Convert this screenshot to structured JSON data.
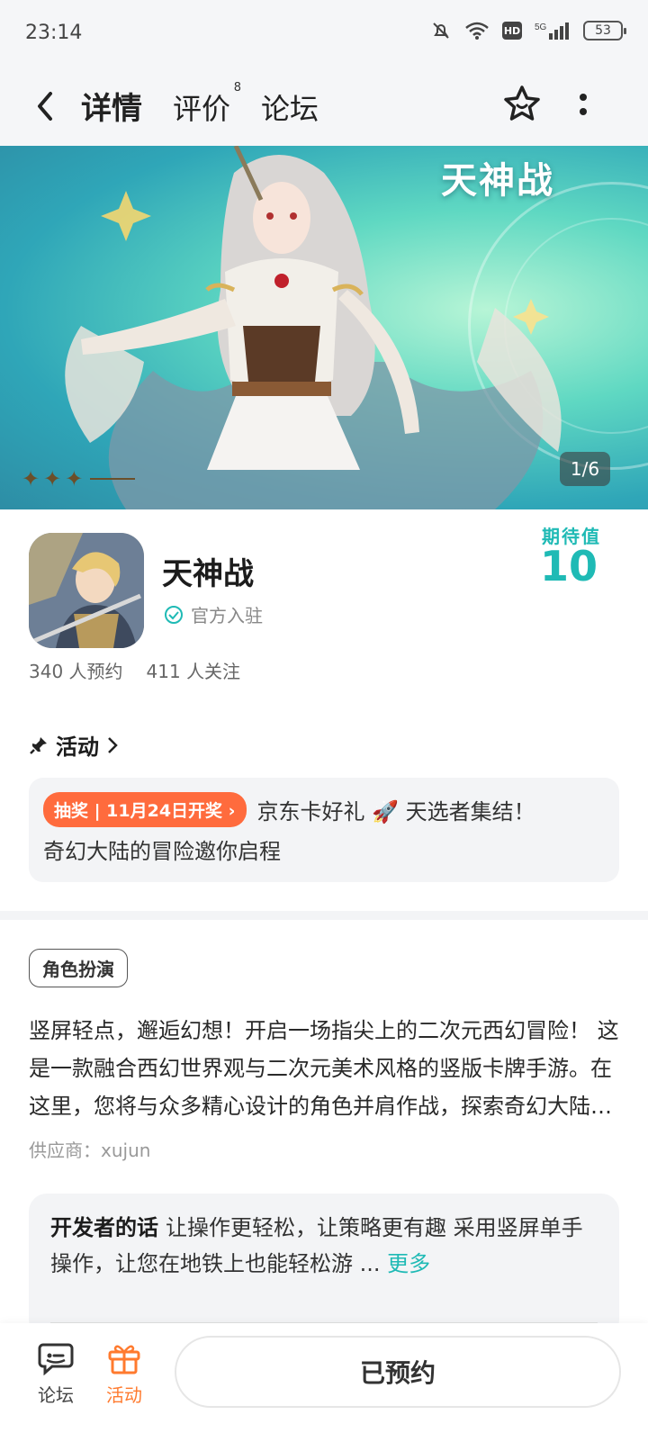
{
  "status_bar": {
    "time": "23:14",
    "network": "5G",
    "hd": "HD",
    "battery": "53"
  },
  "nav": {
    "back_icon": "chevron-left-icon",
    "tabs": [
      {
        "label": "详情",
        "active": true
      },
      {
        "label": "评价",
        "badge": "8"
      },
      {
        "label": "论坛"
      }
    ],
    "favorite_icon": "star-icon",
    "more_icon": "more-vertical-icon"
  },
  "banner": {
    "logo_text": "天神战",
    "counter": "1/6"
  },
  "game": {
    "name": "天神战",
    "official_label": "官方入驻",
    "expect_label": "期待值",
    "expect_value": "10",
    "reservations": "340 人预约",
    "followers": "411 人关注"
  },
  "activity": {
    "title": "活动",
    "tag": "抽奖 | 11月24日开奖 ›",
    "line1": "京东卡好礼 🚀 天选者集结！",
    "line2": "奇幻大陆的冒险邀你启程"
  },
  "description": {
    "genre": "角色扮演",
    "text": "竖屏轻点，邂逅幻想！开启一场指尖上的二次元西幻冒险！ 这是一款融合西幻世界观与二次元美术风格的竖版卡牌手游。在这里，您将与众多精心设计的角色并肩作战，探索奇幻大陆的无尽秘境。",
    "supplier": "供应商：xujun"
  },
  "developer": {
    "label": "开发者的话",
    "text": "让操作更轻松，让策略更有趣 采用竖屏单手操作，让您在地铁上也能轻松游 ...",
    "more": "更多"
  },
  "bottom": {
    "forum_label": "论坛",
    "activity_label": "活动",
    "reserve_label": "已预约"
  },
  "colors": {
    "accent": "#1fc6c0",
    "orange": "#ff6b3d"
  }
}
